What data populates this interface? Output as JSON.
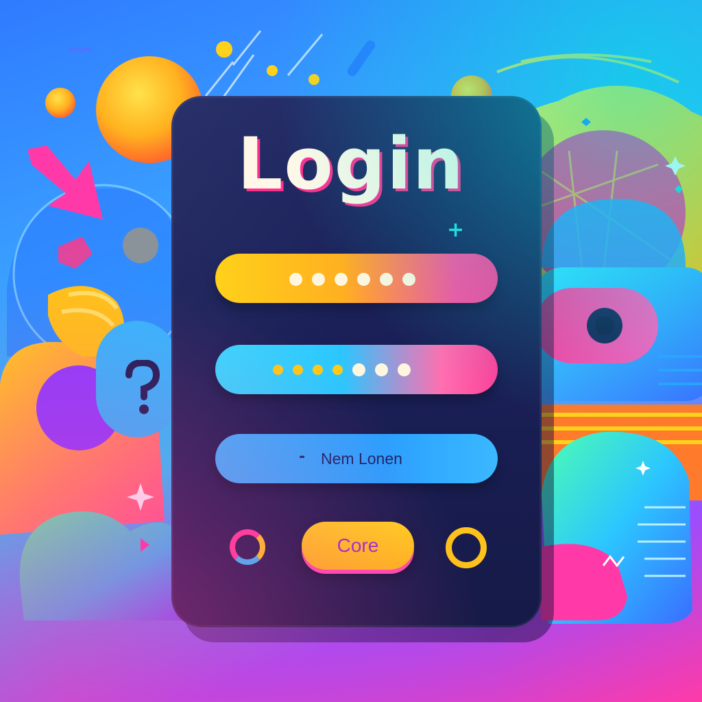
{
  "login": {
    "title": "Login",
    "username_dots": 6,
    "password_dots": 7,
    "name_field_text": "Nem Lonen",
    "button_label": "Core"
  },
  "colors": {
    "card": "#1c2461",
    "accent_pink": "#ff3f9a",
    "accent_yellow": "#ffd11a",
    "accent_cyan": "#2cc6ff"
  },
  "icons": {
    "question": "question-icon",
    "arrow": "arrow-pointer-icon",
    "spinner": "spinner-icon",
    "ring": "ring-icon",
    "plus": "plus-icon"
  }
}
